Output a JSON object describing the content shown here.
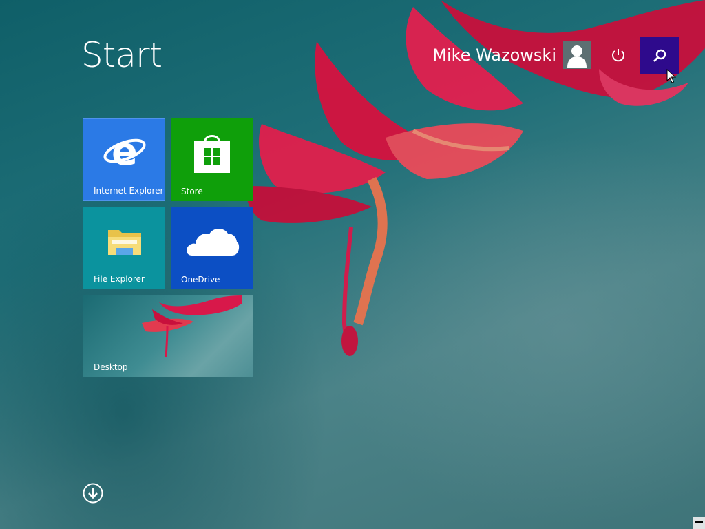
{
  "screen": {
    "title": "Start"
  },
  "user": {
    "name": "Mike Wazowski"
  },
  "header": {
    "power_icon": "power-icon",
    "search_icon": "search-icon"
  },
  "tiles": [
    {
      "label": "Internet Explorer",
      "icon": "internet-explorer-icon",
      "color": "#2b7ae6"
    },
    {
      "label": "Store",
      "icon": "store-icon",
      "color": "#0f9f0a"
    },
    {
      "label": "File Explorer",
      "icon": "folder-icon",
      "color": "#0b939e"
    },
    {
      "label": "OneDrive",
      "icon": "cloud-icon",
      "color": "#0c4fc4"
    },
    {
      "label": "Desktop",
      "icon": "desktop-wallpaper-thumbnail",
      "color": "#3f8c92"
    }
  ],
  "colors": {
    "search_accent": "#2e0a8c",
    "flower": "#d81b4a"
  }
}
